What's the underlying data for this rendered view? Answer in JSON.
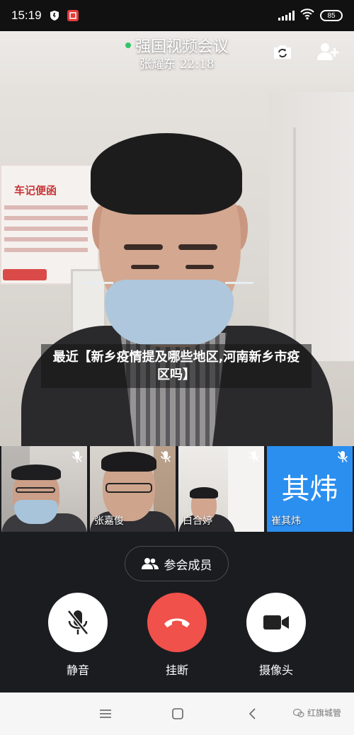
{
  "status_bar": {
    "time": "15:19",
    "battery": "85",
    "icons": [
      "shield-app-icon",
      "red-app-icon",
      "signal-icon",
      "wifi-icon",
      "battery-icon"
    ]
  },
  "meeting": {
    "title": "强国视频会议",
    "speaker_and_time": "张耀东 22:18",
    "status_color": "#34c468",
    "header_icons": [
      "switch-camera-icon",
      "add-person-icon"
    ]
  },
  "main_video": {
    "speaker": "张耀东",
    "background_poster_text": "车记便函"
  },
  "caption": {
    "text": "最近【新乡疫情提及哪些地区,河南新乡市疫区吗】"
  },
  "participants": [
    {
      "name": "",
      "mic": "muted"
    },
    {
      "name": "张嘉俊",
      "mic": "muted"
    },
    {
      "name": "白合婷",
      "mic": "muted"
    },
    {
      "name": "崔其炜",
      "avatar_text": "其炜",
      "avatar_color": "#2b8ff0",
      "mic": "muted"
    }
  ],
  "controls": {
    "members_label": "参会成员",
    "mute_label": "静音",
    "hangup_label": "挂断",
    "camera_label": "摄像头",
    "hangup_color": "#f0514a"
  },
  "navbar": {
    "watermark": "红旗城管",
    "buttons": [
      "menu",
      "home",
      "back"
    ]
  }
}
